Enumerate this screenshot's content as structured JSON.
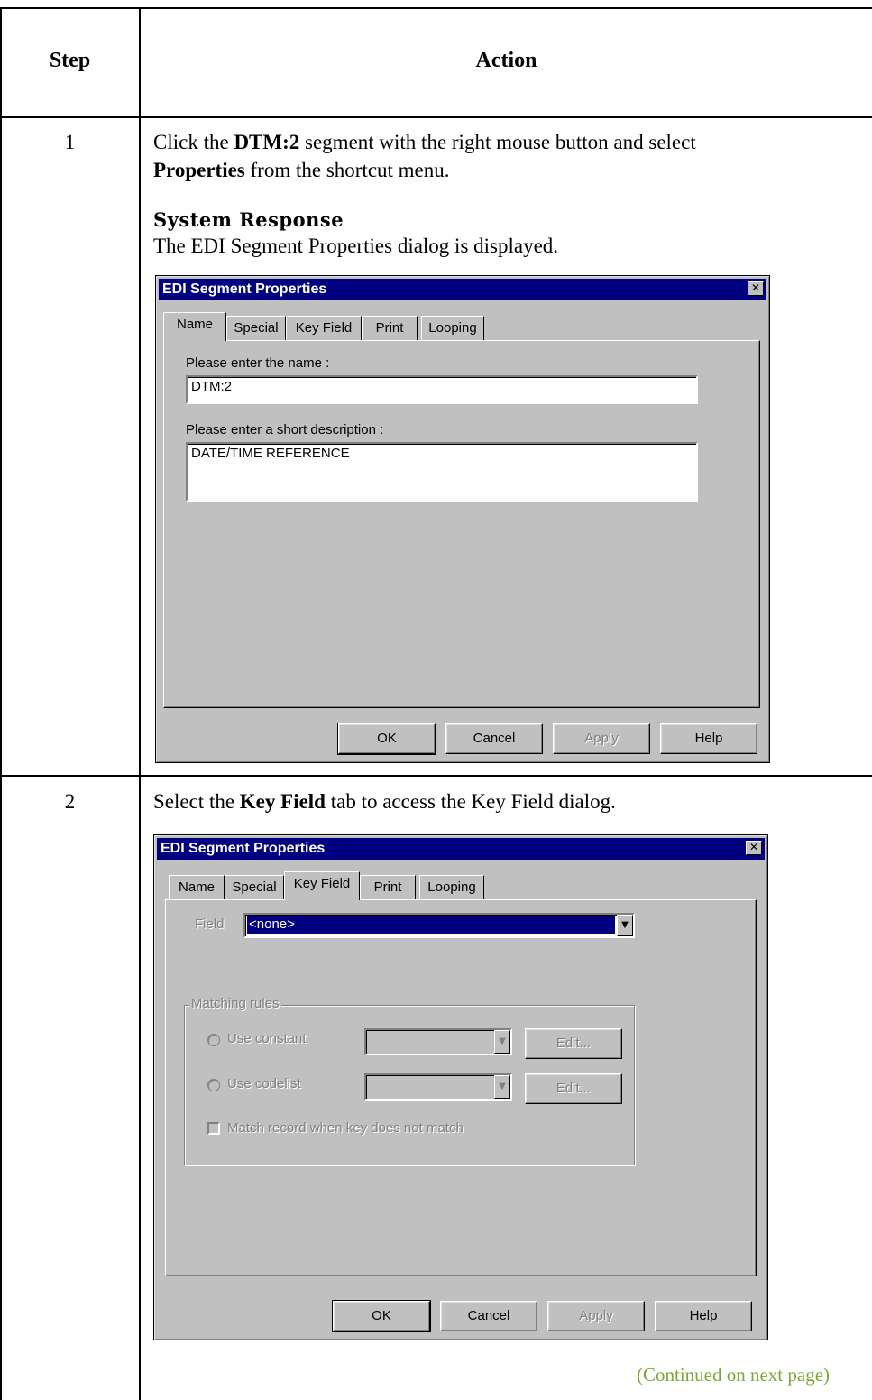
{
  "table": {
    "step_header": "Step",
    "action_header": "Action"
  },
  "step1": {
    "number": "1",
    "instr_a": "Click the ",
    "instr_bold1": "DTM:2",
    "instr_b": " segment with the right mouse button and select",
    "instr_bold2": "Properties",
    "instr_c": " from the shortcut menu.",
    "response_heading": "System Response",
    "response_text": "The EDI Segment Properties dialog is displayed."
  },
  "dialog1": {
    "title": "EDI Segment Properties",
    "close_glyph": "✕",
    "tabs": [
      "Name",
      "Special",
      "Key Field",
      "Print",
      "Looping"
    ],
    "name_label": "Please enter the name :",
    "name_value": "DTM:2",
    "desc_label": "Please enter a short description :",
    "desc_value": "DATE/TIME REFERENCE",
    "buttons": {
      "ok": "OK",
      "cancel": "Cancel",
      "apply": "Apply",
      "help": "Help"
    }
  },
  "step2": {
    "number": "2",
    "instr_a": "Select the ",
    "instr_bold": "Key Field",
    "instr_b": " tab to access the Key Field dialog."
  },
  "dialog2": {
    "title": "EDI Segment Properties",
    "close_glyph": "✕",
    "tabs": [
      "Name",
      "Special",
      "Key Field",
      "Print",
      "Looping"
    ],
    "field_label": "Field",
    "field_value": "<none>",
    "group_label": "Matching rules",
    "use_constant": "Use constant",
    "use_codelist": "Use codelist",
    "edit_label": "Edit...",
    "match_record": "Match record when key does not match",
    "buttons": {
      "ok": "OK",
      "cancel": "Cancel",
      "apply": "Apply",
      "help": "Help"
    }
  },
  "footer": {
    "continued": "(Continued on next page)"
  }
}
